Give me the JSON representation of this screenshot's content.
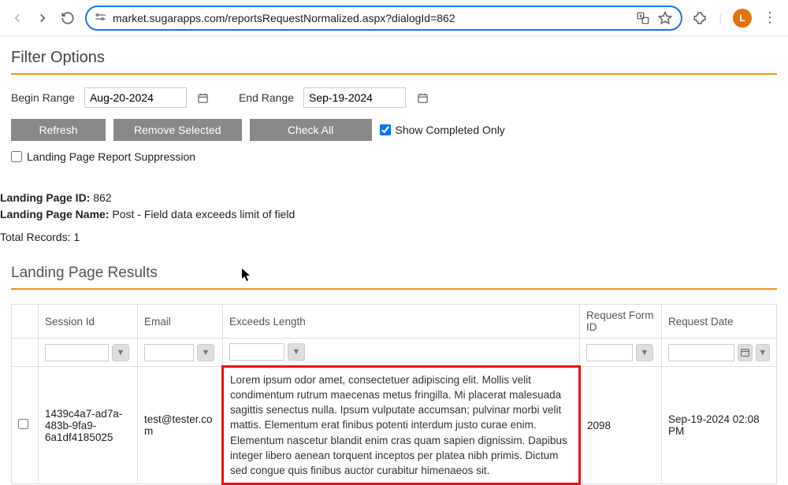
{
  "chrome": {
    "url": "market.sugarapps.com/reportsRequestNormalized.aspx?dialogId=862",
    "avatar_initial": "L"
  },
  "filter": {
    "title": "Filter Options",
    "begin_label": "Begin Range",
    "begin_value": "Aug-20-2024",
    "end_label": "End Range",
    "end_value": "Sep-19-2024",
    "refresh": "Refresh",
    "remove": "Remove Selected",
    "checkall": "Check All",
    "show_completed": "Show Completed Only",
    "suppression": "Landing Page Report Suppression"
  },
  "info": {
    "lp_id_label": "Landing Page ID:",
    "lp_id_value": "862",
    "lp_name_label": "Landing Page Name:",
    "lp_name_value": "Post - Field data exceeds limit of field",
    "total_label": "Total Records:",
    "total_value": "1"
  },
  "results": {
    "title": "Landing Page Results",
    "headers": {
      "session": "Session Id",
      "email": "Email",
      "exceeds": "Exceeds Length",
      "reqid": "Request Form ID",
      "reqdate": "Request Date"
    },
    "row": {
      "session": "1439c4a7-ad7a-483b-9fa9-6a1df4185025",
      "email": "test@tester.com",
      "exceeds": "Lorem ipsum odor amet, consectetuer adipiscing elit. Mollis velit condimentum rutrum maecenas metus fringilla. Mi placerat malesuada sagittis senectus nulla. Ipsum vulputate accumsan; pulvinar morbi velit mattis. Elementum erat finibus potenti interdum justo curae enim. Elementum nascetur blandit enim cras quam sapien dignissim. Dapibus integer libero aenean torquent inceptos per platea nibh primis. Dictum sed congue quis finibus auctor curabitur himenaeos sit.",
      "reqid": "2098",
      "reqdate": "Sep-19-2024 02:08 PM"
    }
  }
}
